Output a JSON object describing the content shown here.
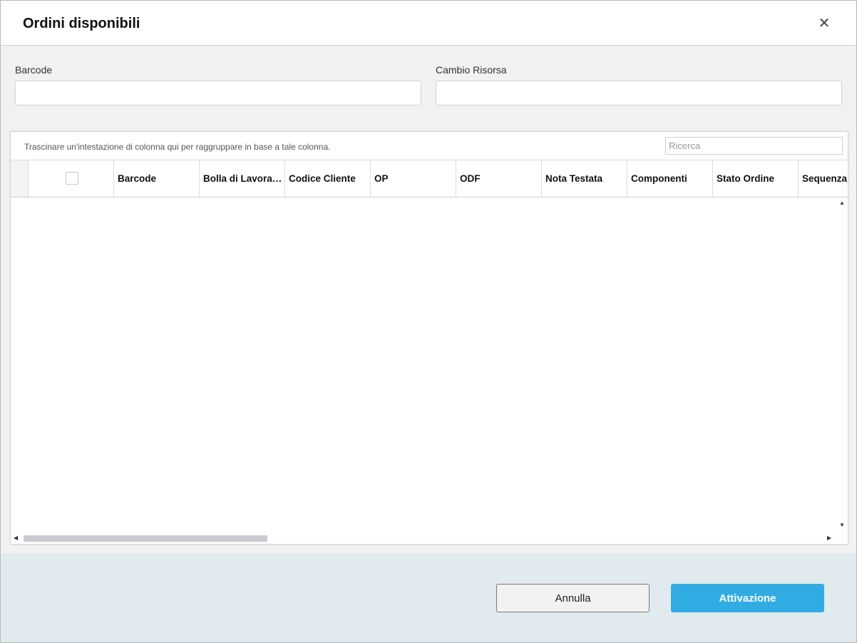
{
  "dialog": {
    "title": "Ordini disponibili",
    "close_icon": "close-icon"
  },
  "form": {
    "barcode_label": "Barcode",
    "barcode_value": "",
    "risorsa_label": "Cambio Risorsa",
    "risorsa_value": ""
  },
  "grid": {
    "group_hint": "Trascinare un'intestazione di colonna qui per raggruppare in base a tale colonna.",
    "search_placeholder": "Ricerca",
    "columns": [
      "Barcode",
      "Bolla di Lavorazione",
      "Codice Cliente",
      "OP",
      "ODF",
      "Nota Testata",
      "Componenti",
      "Stato Ordine",
      "Sequenza"
    ],
    "rows": [],
    "select_all_checked": false
  },
  "footer": {
    "cancel_label": "Annulla",
    "activate_label": "Attivazione"
  },
  "colors": {
    "primary": "#31ace2",
    "footer_bg": "#e1eaee",
    "dialog_bg": "#f2f1f0"
  }
}
